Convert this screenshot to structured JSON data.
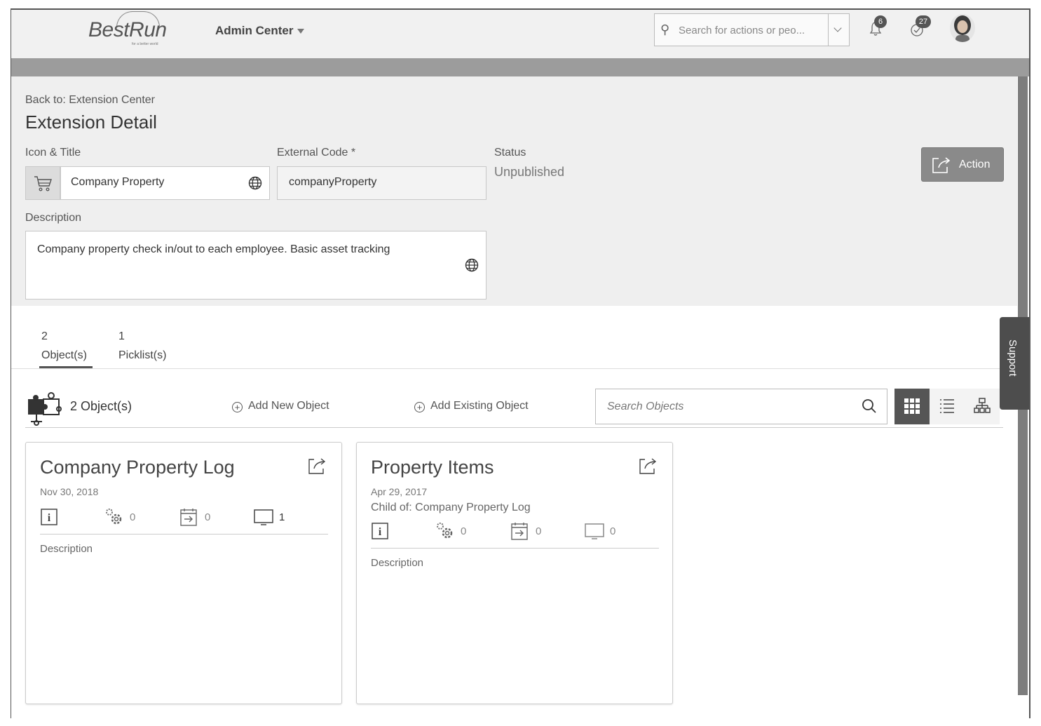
{
  "shell": {
    "logo": "BestRun",
    "logo_sub": "for a better world",
    "menu": "Admin Center",
    "search_placeholder": "Search for actions or peo...",
    "notifications": "6",
    "tasks": "27"
  },
  "header": {
    "back": "Back to: Extension Center",
    "title": "Extension Detail",
    "icon_title_label": "Icon & Title",
    "title_value": "Company Property",
    "external_code_label": "External Code *",
    "external_code_value": "companyProperty",
    "status_label": "Status",
    "status_value": "Unpublished",
    "description_label": "Description",
    "description_value": "Company property check in/out to each employee.  Basic asset tracking",
    "action": "Action"
  },
  "tabs": [
    {
      "count": "2",
      "label": "Object(s)"
    },
    {
      "count": "1",
      "label": "Picklist(s)"
    }
  ],
  "support": "Support",
  "toolbar": {
    "count": "2 Object(s)",
    "add_new": "Add New Object",
    "add_existing": "Add Existing Object",
    "search_placeholder": "Search Objects"
  },
  "cards": [
    {
      "title": "Company Property Log",
      "date": "Nov 30, 2018",
      "child": "",
      "stats": [
        "",
        "0",
        "0",
        "1"
      ],
      "description": "Description"
    },
    {
      "title": "Property Items",
      "date": "Apr 29, 2017",
      "child": "Child of: Company Property Log",
      "stats": [
        "",
        "0",
        "0",
        "0"
      ],
      "description": "Description"
    }
  ]
}
